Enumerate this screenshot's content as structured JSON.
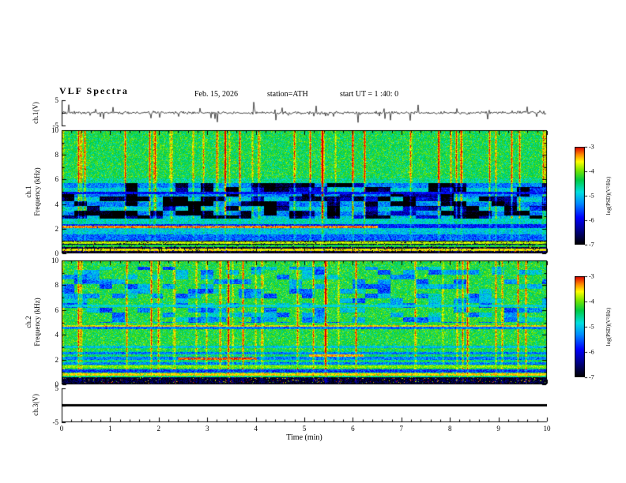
{
  "title": "VLF  Spectra",
  "header": {
    "date": "Feb. 15, 2026",
    "station": "station=ATH",
    "start_ut": "start UT =  1 :40: 0"
  },
  "x_axis": {
    "label": "Time  (min)",
    "range": [
      0,
      10
    ],
    "ticks": [
      0,
      1,
      2,
      3,
      4,
      5,
      6,
      7,
      8,
      9,
      10
    ],
    "minor_step": 0.2
  },
  "colorbar": {
    "label": "log(PSD)(V²/Hz)",
    "range": [
      -3,
      -7
    ],
    "ticks": [
      -3,
      -4,
      -5,
      -6,
      -7
    ],
    "stops": [
      {
        "v": -7.0,
        "c": "#000000"
      },
      {
        "v": -6.4,
        "c": "#000090"
      },
      {
        "v": -5.9,
        "c": "#0000ff"
      },
      {
        "v": -5.3,
        "c": "#0090ff"
      },
      {
        "v": -4.85,
        "c": "#00e0e0"
      },
      {
        "v": -4.35,
        "c": "#00cc44"
      },
      {
        "v": -3.95,
        "c": "#7ae800"
      },
      {
        "v": -3.6,
        "c": "#ffff00"
      },
      {
        "v": -3.3,
        "c": "#ff8800"
      },
      {
        "v": -3.0,
        "c": "#dd0000"
      }
    ]
  },
  "chart_data": [
    {
      "id": "ch1_wave",
      "type": "line",
      "ylabel": "ch.1(V)",
      "ylim": [
        -5,
        5
      ],
      "yticks": [
        5,
        -5
      ],
      "baseline": 0,
      "noise_amp": 0.55,
      "spike_prob": 0.06,
      "spike_max": 4.5,
      "color": "#000000"
    },
    {
      "id": "ch1_spec",
      "type": "heatmap",
      "ylabel_left": "ch.1",
      "ylabel": "Frequency  (kHz)",
      "ylim": [
        0,
        10
      ],
      "yticks": [
        0,
        2,
        4,
        6,
        8,
        10
      ],
      "value_range": [
        -7,
        -3
      ],
      "base": -4.35,
      "noise": 0.4,
      "streak_rate": 0.07,
      "streak_gain": 1.15,
      "streak_seed": 777,
      "bands": [
        {
          "f0": 0.0,
          "f1": 1.05,
          "set": -6.8,
          "speckle": 0.06
        },
        {
          "f0": 1.05,
          "f1": 1.55,
          "set": -5.5
        },
        {
          "f0": 1.55,
          "f1": 2.05,
          "set": -4.95
        },
        {
          "f0": 2.05,
          "f1": 2.4,
          "set": -5.8
        },
        {
          "f0": 2.4,
          "f1": 2.8,
          "set": -4.8
        },
        {
          "f0": 2.85,
          "f1": 5.7,
          "dv": -0.55,
          "stripe_period": 0.38,
          "stripe_dv": -0.45
        },
        {
          "f0": 5.7,
          "f1": 6.1,
          "dv": -0.25
        }
      ],
      "patch": {
        "f0": 2.85,
        "f1": 5.7,
        "threshold": 0.53,
        "dv": -1.6,
        "t_frac_end": 0.44,
        "extra": -0.45
      },
      "lines": [
        {
          "f": 0.35,
          "v": -3.6,
          "px": 1,
          "t0": 0,
          "t1": 10
        },
        {
          "f": 0.62,
          "v": -4.3,
          "px": 1,
          "t0": 0,
          "t1": 10
        },
        {
          "f": 0.9,
          "v": -3.8,
          "px": 1,
          "t0": 0,
          "t1": 10
        },
        {
          "f": 2.2,
          "v": -3.3,
          "px": 1,
          "t0": 0,
          "t1": 6.5
        },
        {
          "f": 4.95,
          "v": -5.9,
          "px": 1,
          "t0": 0,
          "t1": 10
        }
      ]
    },
    {
      "id": "ch2_spec",
      "type": "heatmap",
      "ylabel_left": "ch.2",
      "ylabel": "Frequency  (kHz)",
      "ylim": [
        0,
        10
      ],
      "yticks": [
        0,
        2,
        4,
        6,
        8,
        10
      ],
      "value_range": [
        -7,
        -3
      ],
      "base": -4.3,
      "noise": 0.4,
      "streak_rate": 0.06,
      "streak_gain": 1.0,
      "streak_seed": 777,
      "bands": [
        {
          "f0": 0.0,
          "f1": 0.55,
          "set": -6.8,
          "speckle": 0.05
        },
        {
          "f0": 0.55,
          "f1": 0.72,
          "set": -4.5
        },
        {
          "f0": 0.95,
          "f1": 1.2,
          "set": -5.7
        },
        {
          "f0": 1.55,
          "f1": 2.75,
          "dv": -0.15,
          "stripe_period": 0.2,
          "stripe_dv": -0.9
        },
        {
          "f0": 2.95,
          "f1": 3.15,
          "dv": -0.7
        },
        {
          "f0": 4.45,
          "f1": 4.62,
          "set": -5.4
        },
        {
          "f0": 4.62,
          "f1": 4.8,
          "set": -3.6
        }
      ],
      "patch": {
        "f0": 5.0,
        "f1": 9.5,
        "threshold": 0.62,
        "dv": -0.9,
        "t_frac_end": 0,
        "extra": 0
      },
      "lines": [
        {
          "f": 0.85,
          "v": -3.5,
          "px": 1,
          "t0": 0,
          "t1": 10
        },
        {
          "f": 1.45,
          "v": -3.9,
          "px": 1,
          "t0": 0,
          "t1": 10
        },
        {
          "f": 2.1,
          "v": -3.2,
          "px": 1,
          "t0": 2.4,
          "t1": 4.0
        },
        {
          "f": 2.35,
          "v": -3.4,
          "px": 1,
          "t0": 5.1,
          "t1": 6.2
        },
        {
          "f": 6.4,
          "v": -4.9,
          "px": 1,
          "t0": 0,
          "t1": 10
        }
      ]
    },
    {
      "id": "ch3_wave",
      "type": "line",
      "ylabel": "ch.3(V)",
      "ylim": [
        -5,
        5
      ],
      "yticks": [
        5,
        -5
      ],
      "constant": 0,
      "thickness": 3,
      "color": "#000000"
    }
  ]
}
